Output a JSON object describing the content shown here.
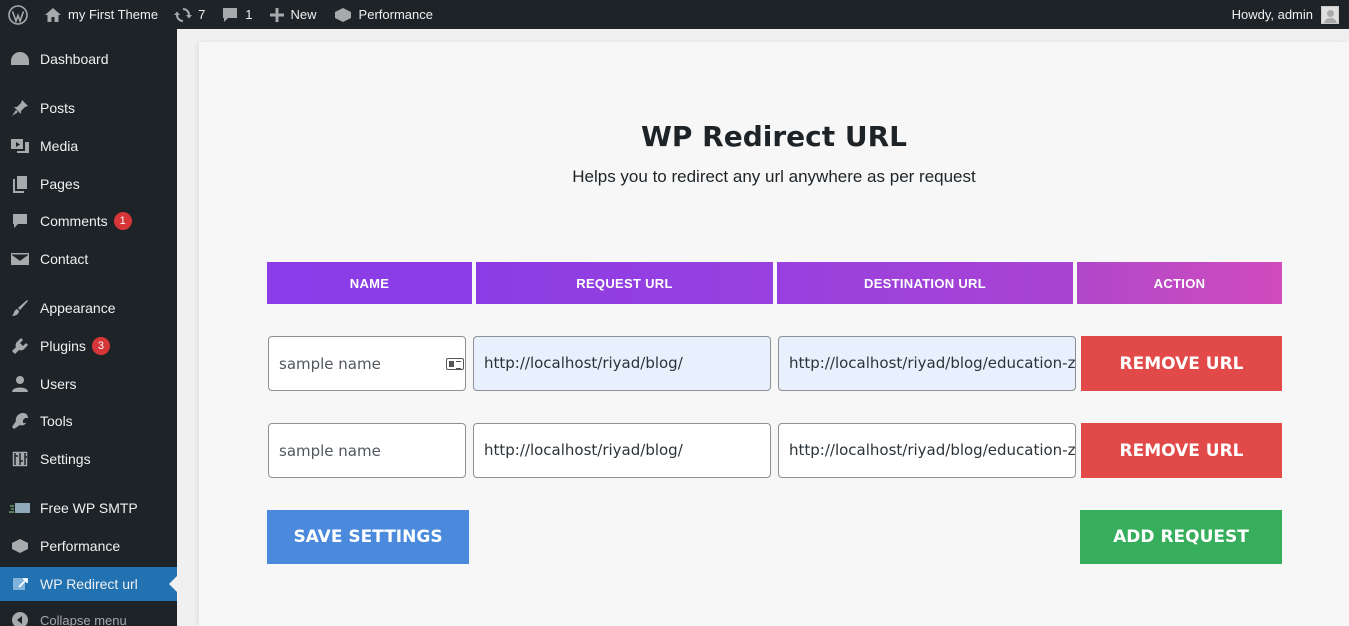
{
  "adminbar": {
    "site_name": "my First Theme",
    "updates_count": "7",
    "comments_count": "1",
    "new_label": "New",
    "performance_label": "Performance",
    "greeting": "Howdy, admin"
  },
  "sidebar": {
    "items": [
      {
        "label": "Dashboard",
        "icon": "dashboard-icon"
      },
      {
        "label": "Posts",
        "icon": "pin-icon"
      },
      {
        "label": "Media",
        "icon": "media-icon"
      },
      {
        "label": "Pages",
        "icon": "pages-icon"
      },
      {
        "label": "Comments",
        "icon": "comment-icon",
        "badge": "1"
      },
      {
        "label": "Contact",
        "icon": "mail-icon"
      },
      {
        "label": "Appearance",
        "icon": "brush-icon"
      },
      {
        "label": "Plugins",
        "icon": "plugin-icon",
        "badge": "3"
      },
      {
        "label": "Users",
        "icon": "user-icon"
      },
      {
        "label": "Tools",
        "icon": "wrench-icon"
      },
      {
        "label": "Settings",
        "icon": "settings-icon"
      },
      {
        "label": "Free WP SMTP",
        "icon": "smtp-icon"
      },
      {
        "label": "Performance",
        "icon": "performance-icon"
      },
      {
        "label": "WP Redirect url",
        "icon": "redirect-icon",
        "current": true
      },
      {
        "label": "Collapse menu",
        "icon": "collapse-icon"
      }
    ]
  },
  "page": {
    "title": "WP Redirect URL",
    "subtitle": "Helps you to redirect any url anywhere as per request"
  },
  "table": {
    "headers": [
      "NAME",
      "REQUEST URL",
      "DESTINATION URL",
      "ACTION"
    ],
    "rows": [
      {
        "name_placeholder": "sample name",
        "request_url": "http://localhost/riyad/blog/",
        "destination_url": "http://localhost/riyad/blog/education-zone/",
        "remove_label": "REMOVE URL"
      },
      {
        "name_placeholder": "sample name",
        "request_url": "http://localhost/riyad/blog/",
        "destination_url": "http://localhost/riyad/blog/education-zone/",
        "remove_label": "REMOVE URL"
      }
    ]
  },
  "actions": {
    "save_label": "SAVE SETTINGS",
    "add_label": "ADD REQUEST"
  },
  "colors": {
    "save": "#4a89dc",
    "add": "#37ae5c",
    "remove": "#e24a4a",
    "header_gradient_start": "#8a3de8",
    "header_gradient_end": "#d04bbd"
  }
}
